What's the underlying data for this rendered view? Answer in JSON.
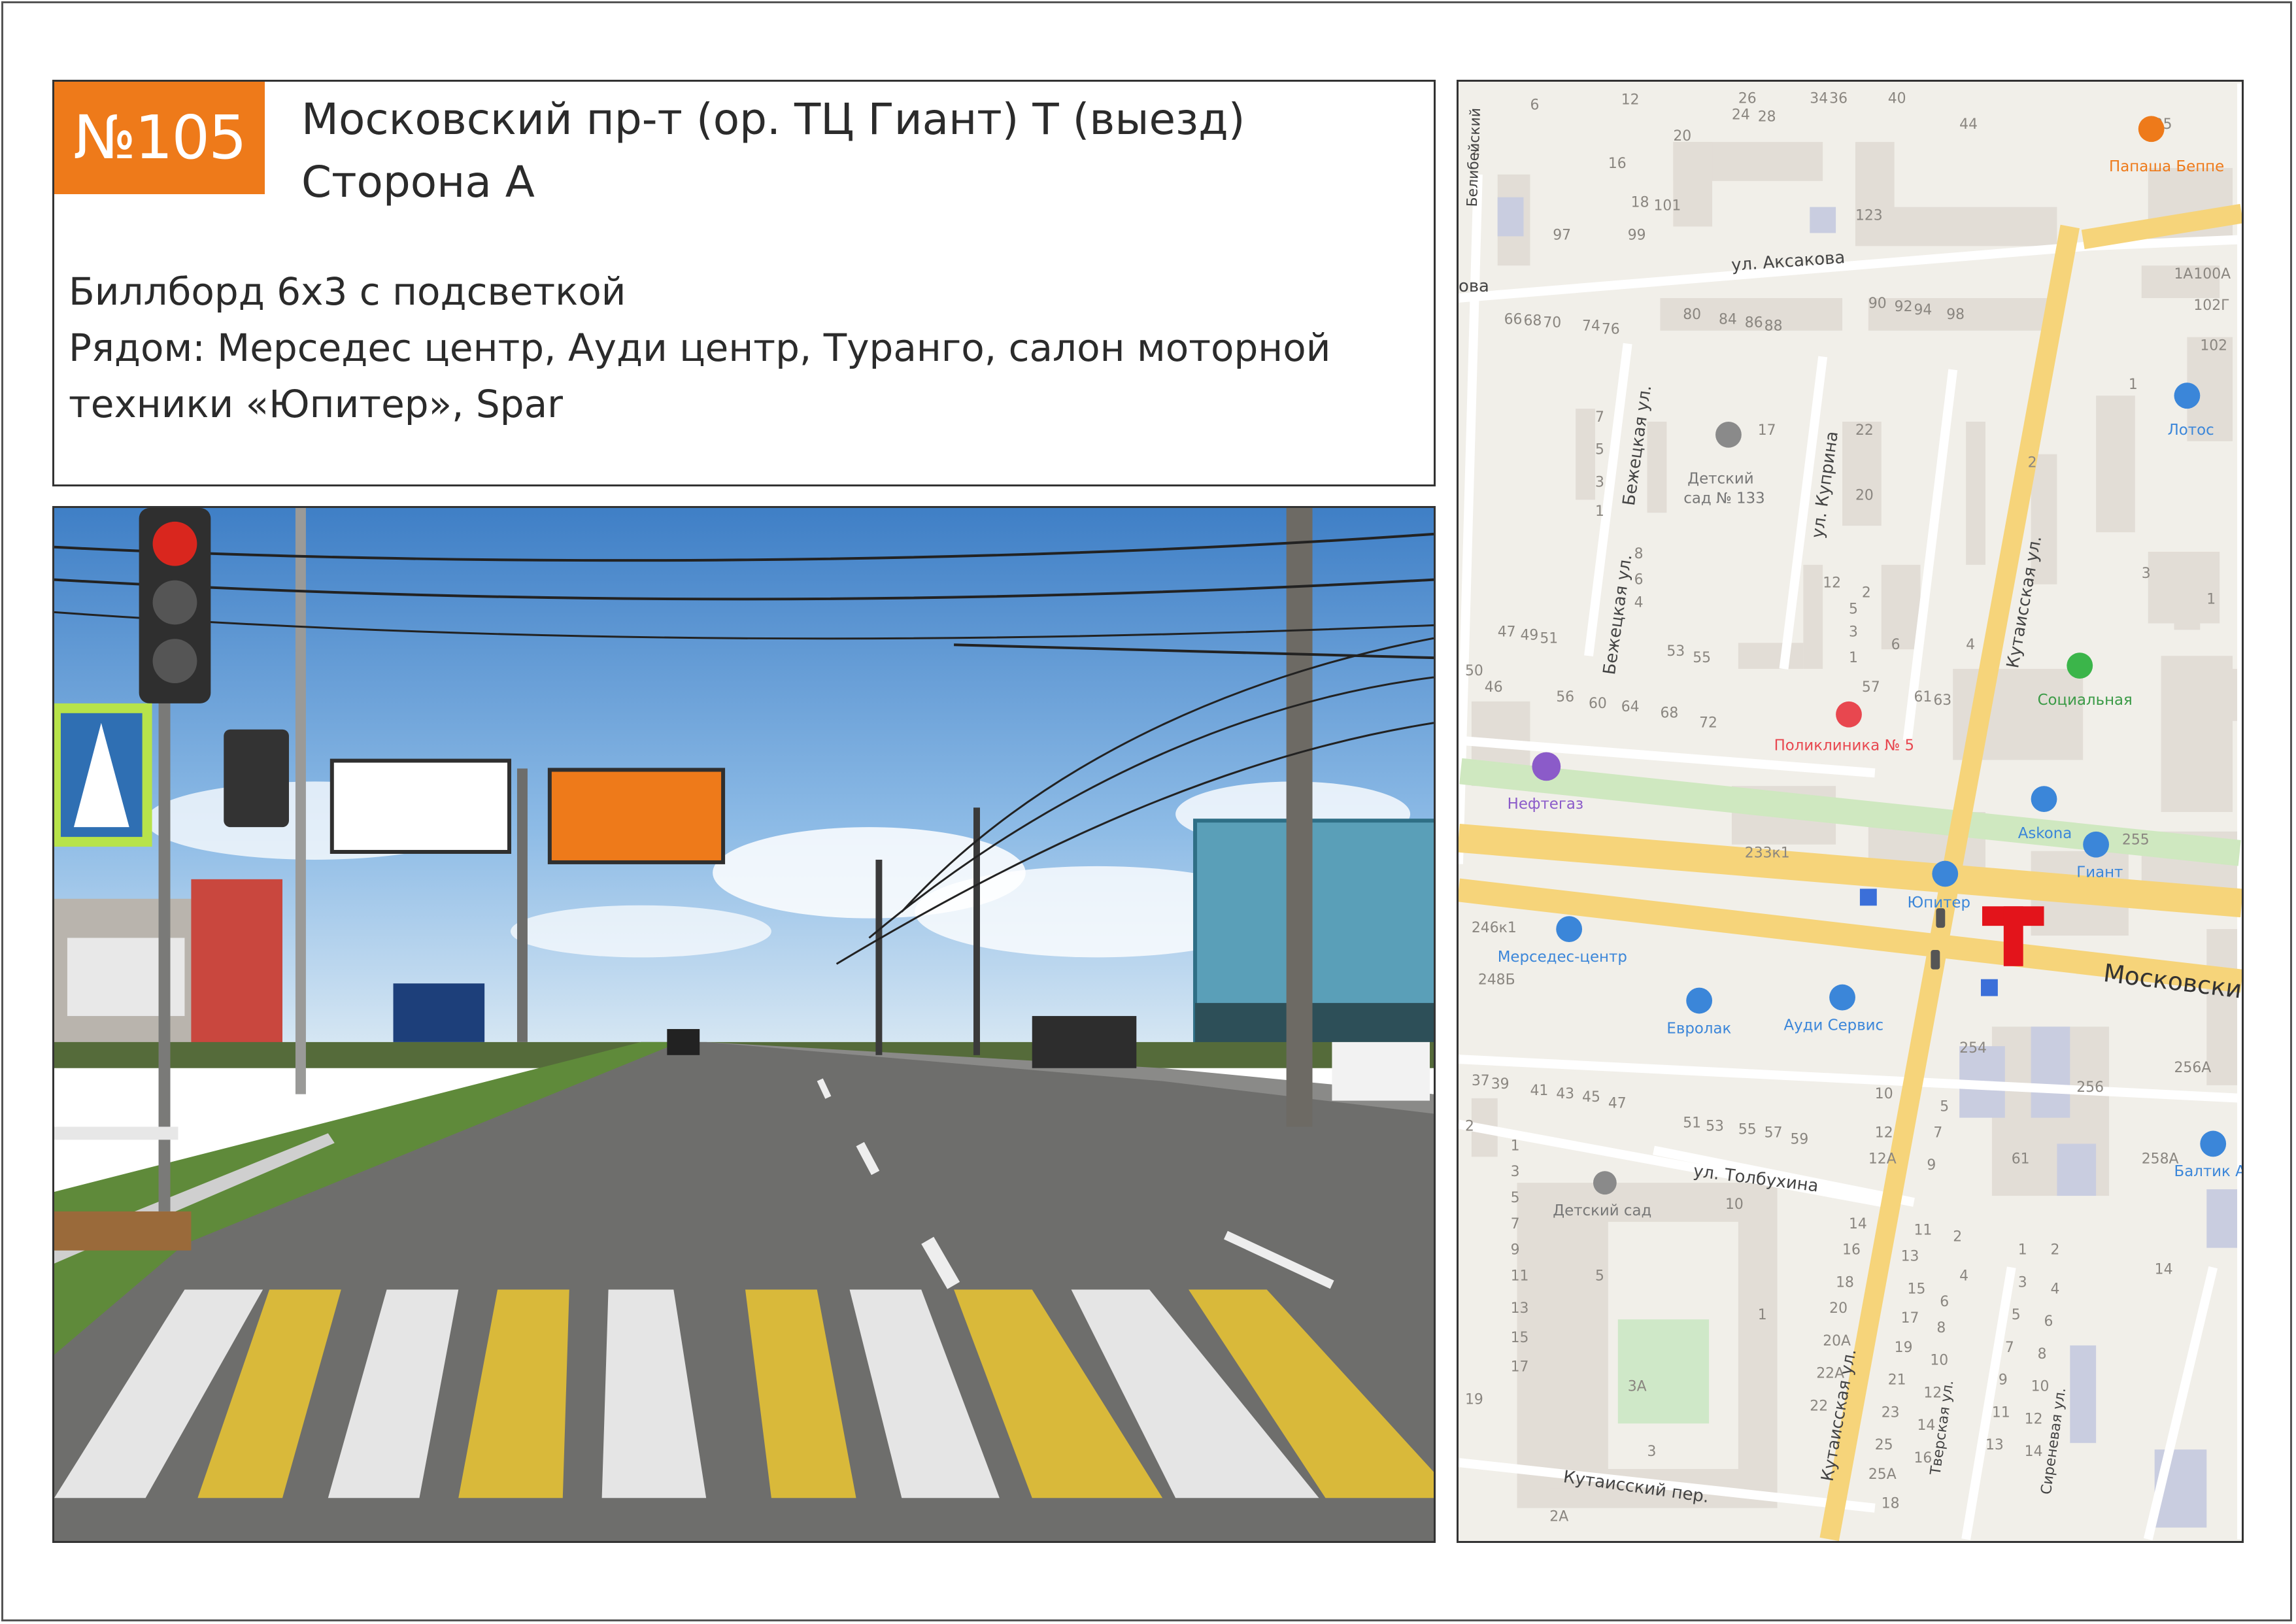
{
  "header": {
    "number": "№105",
    "title_line1": "Московский пр-т (ор. ТЦ Гиант) Т  (выезд)",
    "title_line2": "Сторона А",
    "desc_line1": "Биллборд 6х3 с подсветкой",
    "desc_line2": "Рядом: Мерседес центр, Ауди центр, Туранго, салон моторной",
    "desc_line3": "техники «Юпитер», Spar"
  },
  "map": {
    "streets": {
      "aksakova": "ул. Аксакова",
      "bezhetskaya1": "Бежецкая ул.",
      "bezhetskaya2": "Бежецкая ул.",
      "kuprina": "ул. Куприна",
      "kutaisskaya1": "Кутаисская ул.",
      "kutaisskaya2": "Кутаисская ул.",
      "moskovsky": "Московский",
      "tolbukhina": "ул. Толбухина",
      "kutaissky_per": "Кутаисский пер.",
      "tverskaya": "Тверская ул.",
      "sirenevaya": "Сиреневая ул.",
      "belibeisky": "Белибейский",
      "ova": "ова"
    },
    "pois": {
      "papasha": "Папаша Беппе",
      "lotos": "Лотос",
      "kindergarten133_1": "Детский",
      "kindergarten133_2": "сад № 133",
      "social": "Социальная",
      "clinic": "Поликлиника № 5",
      "neftegaz": "Нефтегаз",
      "askona": "Askona",
      "giant": "Гиант",
      "jupiter": "Юпитер",
      "mercedes": "Мерседес-центр",
      "evrolak": "Евролак",
      "audi": "Ауди Сервис",
      "baltika": "Балтик А",
      "kindergarten": "Детский сад"
    },
    "marker": "T",
    "colors": {
      "badge": "#ee7a1a",
      "marker": "#e3141b",
      "major_road": "#f6d47a",
      "map_bg": "#f1efe9"
    }
  }
}
